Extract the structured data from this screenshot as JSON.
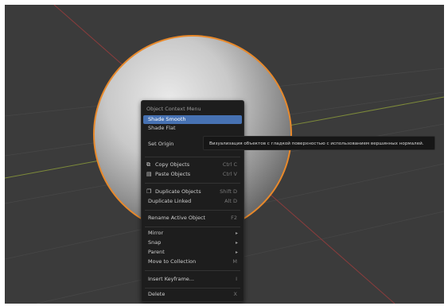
{
  "context_menu": {
    "title": "Object Context Menu",
    "items": [
      {
        "label": "Shade Smooth",
        "shortcut": "",
        "active": true
      },
      {
        "label": "Shade Flat",
        "shortcut": ""
      },
      {
        "label": "Set Origin",
        "shortcut": ""
      },
      {
        "label": "Copy Objects",
        "shortcut": "Ctrl C",
        "icon": "copy-icon"
      },
      {
        "label": "Paste Objects",
        "shortcut": "Ctrl V",
        "icon": "paste-icon"
      },
      {
        "label": "Duplicate Objects",
        "shortcut": "Shift D",
        "icon": "duplicate-icon"
      },
      {
        "label": "Duplicate Linked",
        "shortcut": "Alt D"
      },
      {
        "label": "Rename Active Object",
        "shortcut": "F2"
      },
      {
        "label": "Mirror",
        "submenu": true
      },
      {
        "label": "Snap",
        "submenu": true
      },
      {
        "label": "Parent",
        "submenu": true
      },
      {
        "label": "Move to Collection",
        "shortcut": "M"
      },
      {
        "label": "Insert Keyframe...",
        "shortcut": "I"
      },
      {
        "label": "Delete",
        "shortcut": "X"
      }
    ]
  },
  "tooltip": {
    "text": "Визуализация объектов с гладкой поверхностью с использованием вершинных нормалей."
  },
  "colors": {
    "viewport_bg": "#3b3b3b",
    "grid_line": "#474747",
    "x_axis": "#8a3c3c",
    "y_axis": "#7d8a3a",
    "selection_outline": "#e8892b",
    "menu_bg": "#1d1d1d",
    "menu_highlight": "#4772b3"
  }
}
